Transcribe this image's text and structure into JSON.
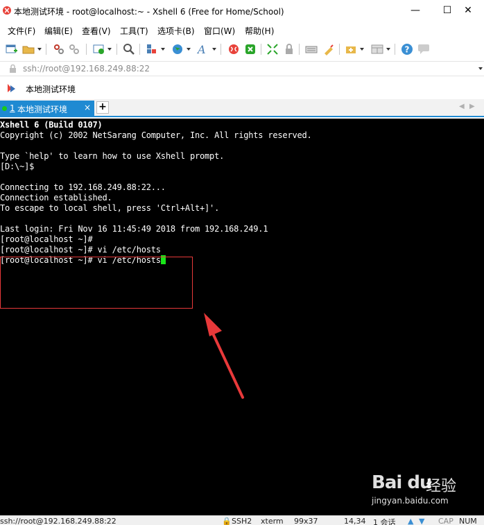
{
  "window": {
    "title": "本地测试环境 - root@localhost:~ - Xshell 6 (Free for Home/School)",
    "minimize_glyph": "—",
    "maximize_glyph": "☐",
    "close_glyph": "✕"
  },
  "menu": [
    "文件(F)",
    "编辑(E)",
    "查看(V)",
    "工具(T)",
    "选项卡(B)",
    "窗口(W)",
    "帮助(H)"
  ],
  "toolbar": {
    "icons": [
      "new-session-icon",
      "open-folder-icon",
      "reconnect-icon",
      "disconnect-icon",
      "properties-icon",
      "find-icon",
      "transfer-icon",
      "globe-icon",
      "font-icon",
      "xftp-icon",
      "xmanager-icon",
      "fullscreen-icon",
      "lock-icon",
      "keyboard-icon",
      "highlight-icon",
      "compose-icon",
      "layout-icon",
      "help-icon",
      "chat-icon"
    ]
  },
  "address": {
    "value": "ssh://root@192.168.249.88:22"
  },
  "links": {
    "label": "本地测试环境"
  },
  "tabs": {
    "active_number": "1",
    "active_label": "本地测试环境",
    "close_glyph": "×",
    "add_glyph": "+",
    "nav_left": "◀",
    "nav_right": "▶"
  },
  "terminal": {
    "lines": [
      "Xshell 6 (Build 0107)",
      "Copyright (c) 2002 NetSarang Computer, Inc. All rights reserved.",
      "",
      "Type `help' to learn how to use Xshell prompt.",
      "[D:\\~]$",
      "",
      "Connecting to 192.168.249.88:22...",
      "Connection established.",
      "To escape to local shell, press 'Ctrl+Alt+]'.",
      "",
      "Last login: Fri Nov 16 11:45:49 2018 from 192.168.249.1",
      "[root@localhost ~]#",
      "[root@localhost ~]# vi /etc/hosts",
      "[root@localhost ~]# vi /etc/hosts"
    ],
    "cursor_color": "#19e619"
  },
  "watermark": {
    "logo": "Bai du",
    "cn": "经验",
    "url": "jingyan.baidu.com"
  },
  "status": {
    "address": "ssh://root@192.168.249.88:22",
    "protocol": "SSH2",
    "term": "xterm",
    "size": "99x37",
    "position": "14,34",
    "sessions": "1 会话",
    "caps": "CAP",
    "num": "NUM"
  },
  "colors": {
    "accent": "#1f8ad2",
    "highlight": "#e8393a",
    "terminal_bg": "#000000"
  }
}
